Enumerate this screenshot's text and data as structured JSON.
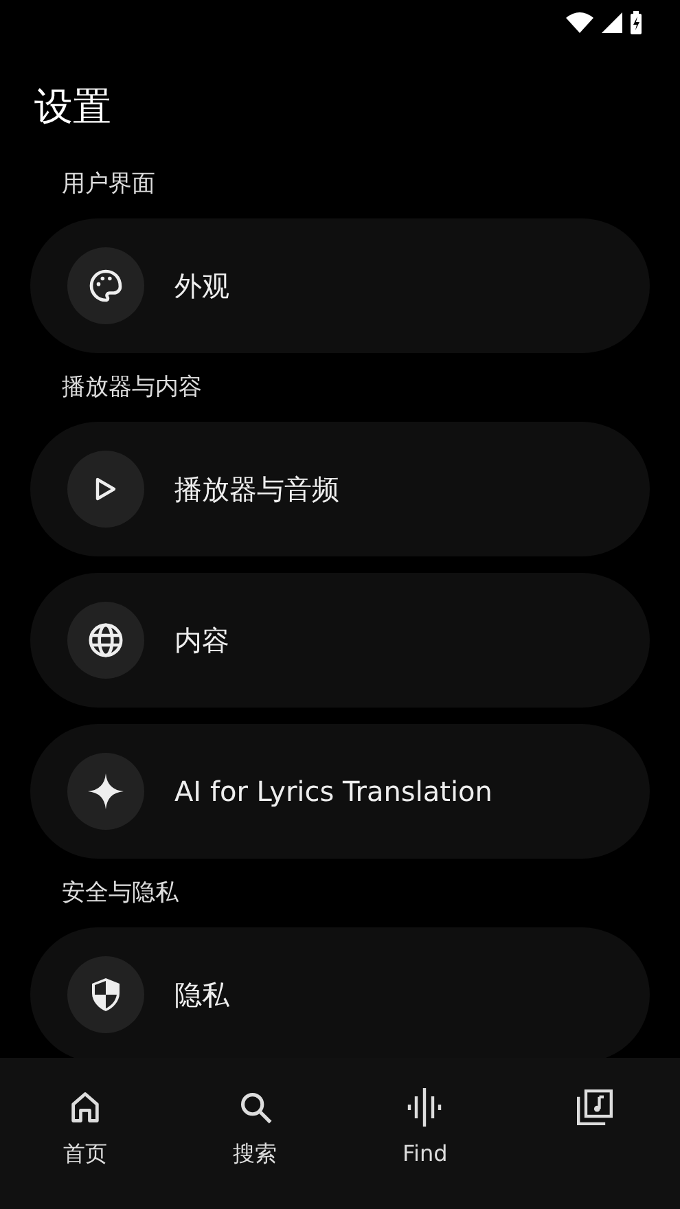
{
  "title": "设置",
  "sections": [
    {
      "label": "用户界面",
      "items": [
        {
          "label": "外观"
        }
      ]
    },
    {
      "label": "播放器与内容",
      "items": [
        {
          "label": "播放器与音频"
        },
        {
          "label": "内容"
        },
        {
          "label": "AI for Lyrics Translation"
        }
      ]
    },
    {
      "label": "安全与隐私",
      "items": [
        {
          "label": "隐私"
        }
      ]
    }
  ],
  "nav": [
    {
      "label": "首页"
    },
    {
      "label": "搜索"
    },
    {
      "label": "Find"
    }
  ]
}
